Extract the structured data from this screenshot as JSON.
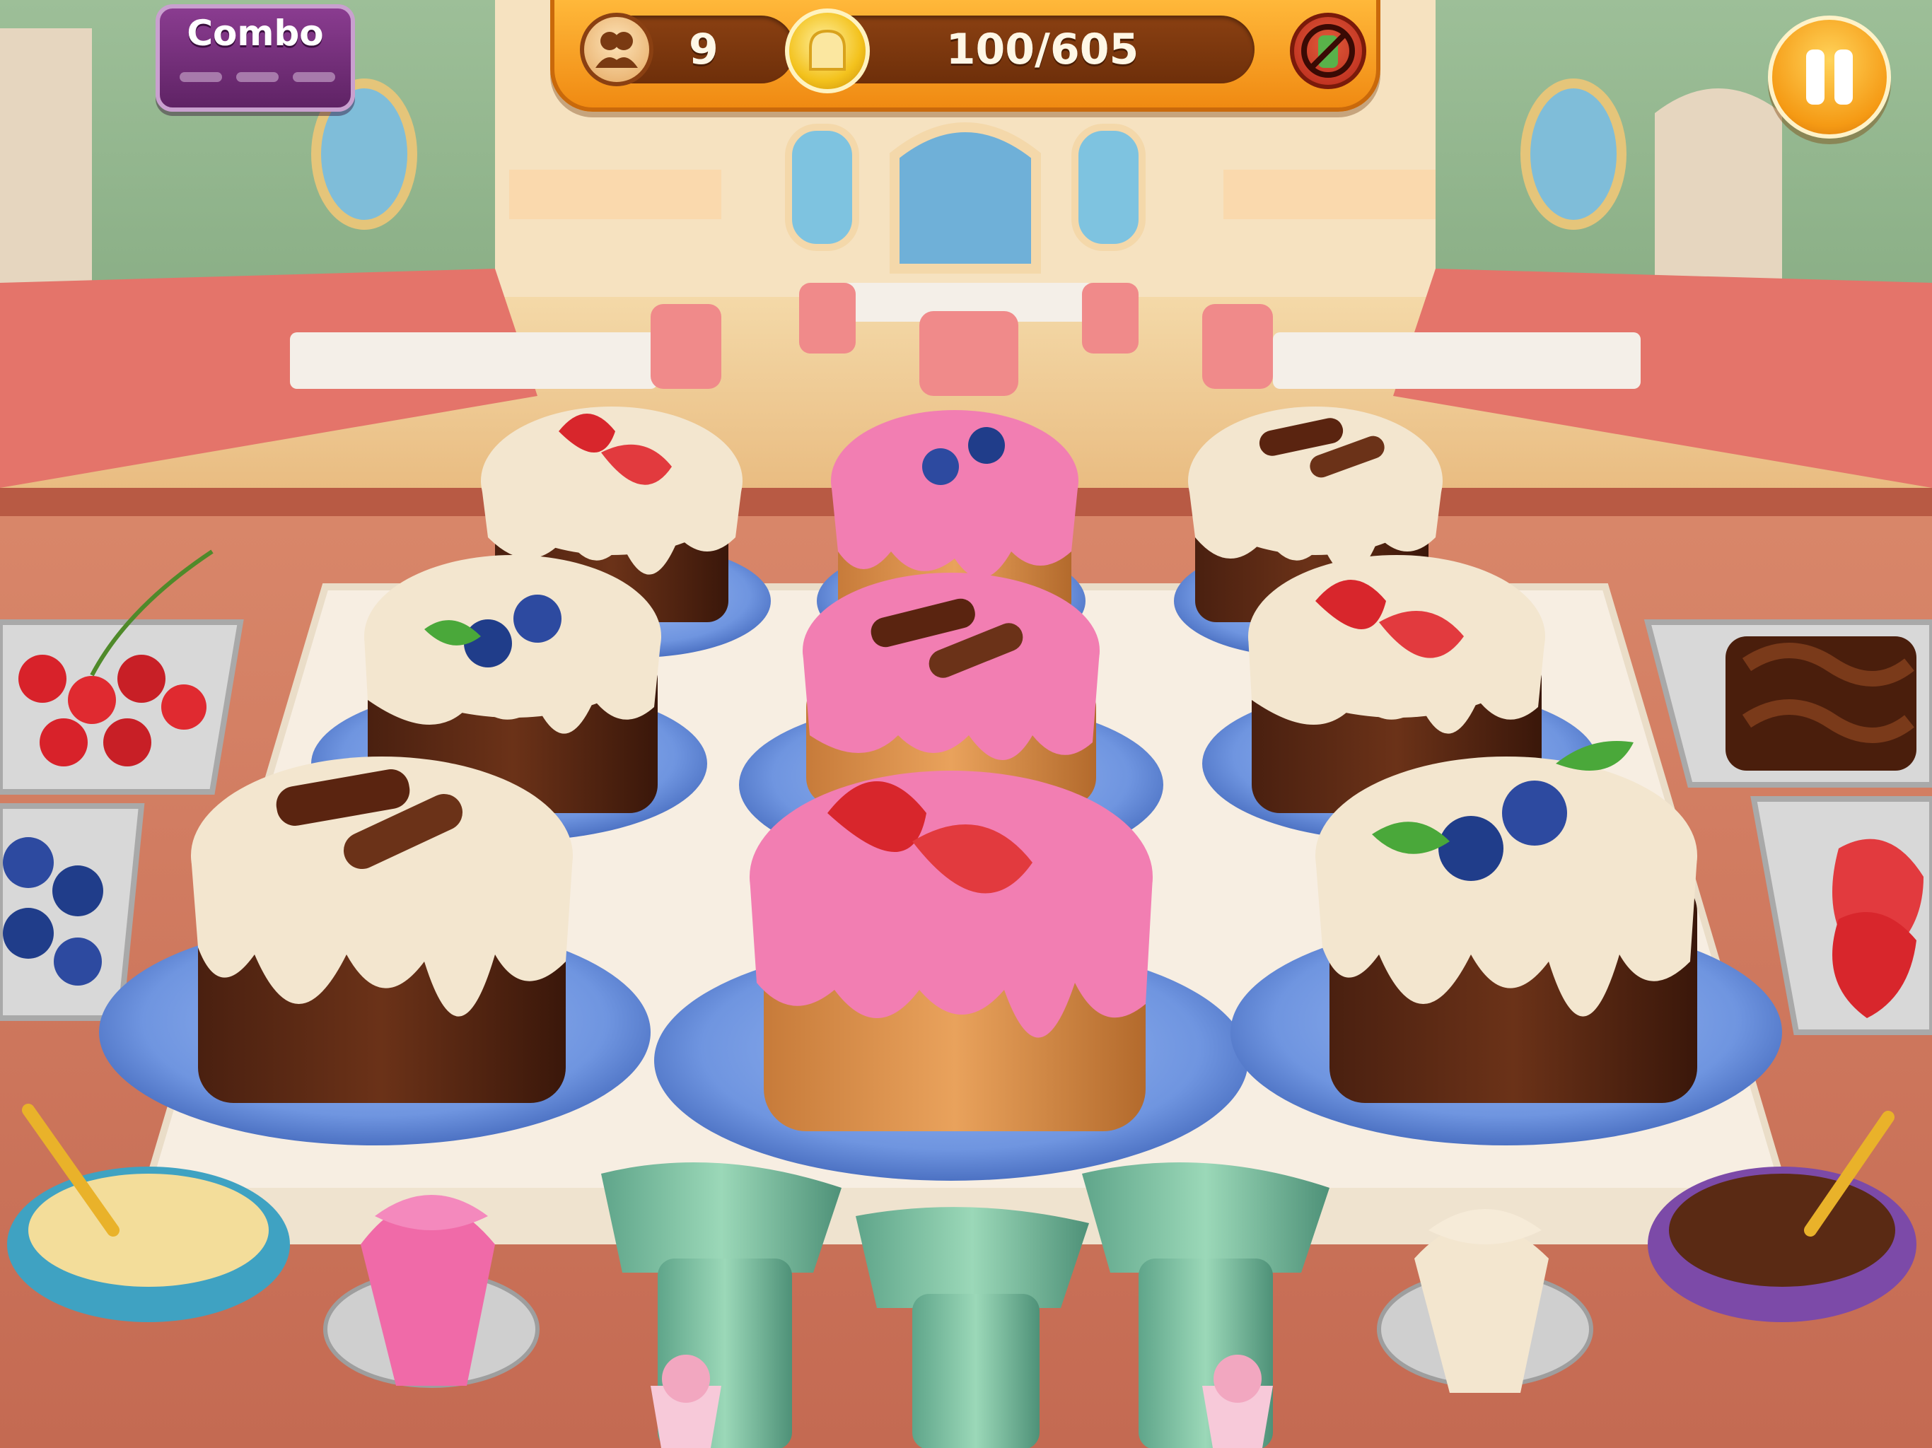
{
  "hud": {
    "customers_count": "9",
    "coins_progress": "100/605",
    "combo_label": "Combo"
  },
  "icons": {
    "customers": "customers-icon",
    "coin": "bread-coin-icon",
    "no_booster": "no-booster-icon",
    "pause": "pause-icon"
  },
  "cakes": [
    {
      "name": "cake-back-left",
      "frosting": "cream",
      "topping": "strawberry"
    },
    {
      "name": "cake-back-center",
      "frosting": "pink",
      "topping": "blueberry"
    },
    {
      "name": "cake-back-right",
      "frosting": "cream",
      "topping": "chocolate-curl"
    },
    {
      "name": "cake-mid-left",
      "frosting": "cream",
      "topping": "blueberry"
    },
    {
      "name": "cake-mid-center",
      "frosting": "pink",
      "topping": "chocolate-curl"
    },
    {
      "name": "cake-mid-right",
      "frosting": "cream",
      "topping": "strawberry"
    },
    {
      "name": "cake-front-left",
      "frosting": "cream",
      "topping": "chocolate-curl"
    },
    {
      "name": "cake-front-center",
      "frosting": "pink",
      "topping": "strawberry"
    },
    {
      "name": "cake-front-right",
      "frosting": "cream",
      "topping": "blueberry"
    }
  ],
  "colors": {
    "hud_orange": "#f5a020",
    "cream_frosting": "#f3e6cf",
    "pink_frosting": "#f27eb2",
    "plate_blue": "#6f95e0",
    "wall_green": "#8fb38c"
  }
}
